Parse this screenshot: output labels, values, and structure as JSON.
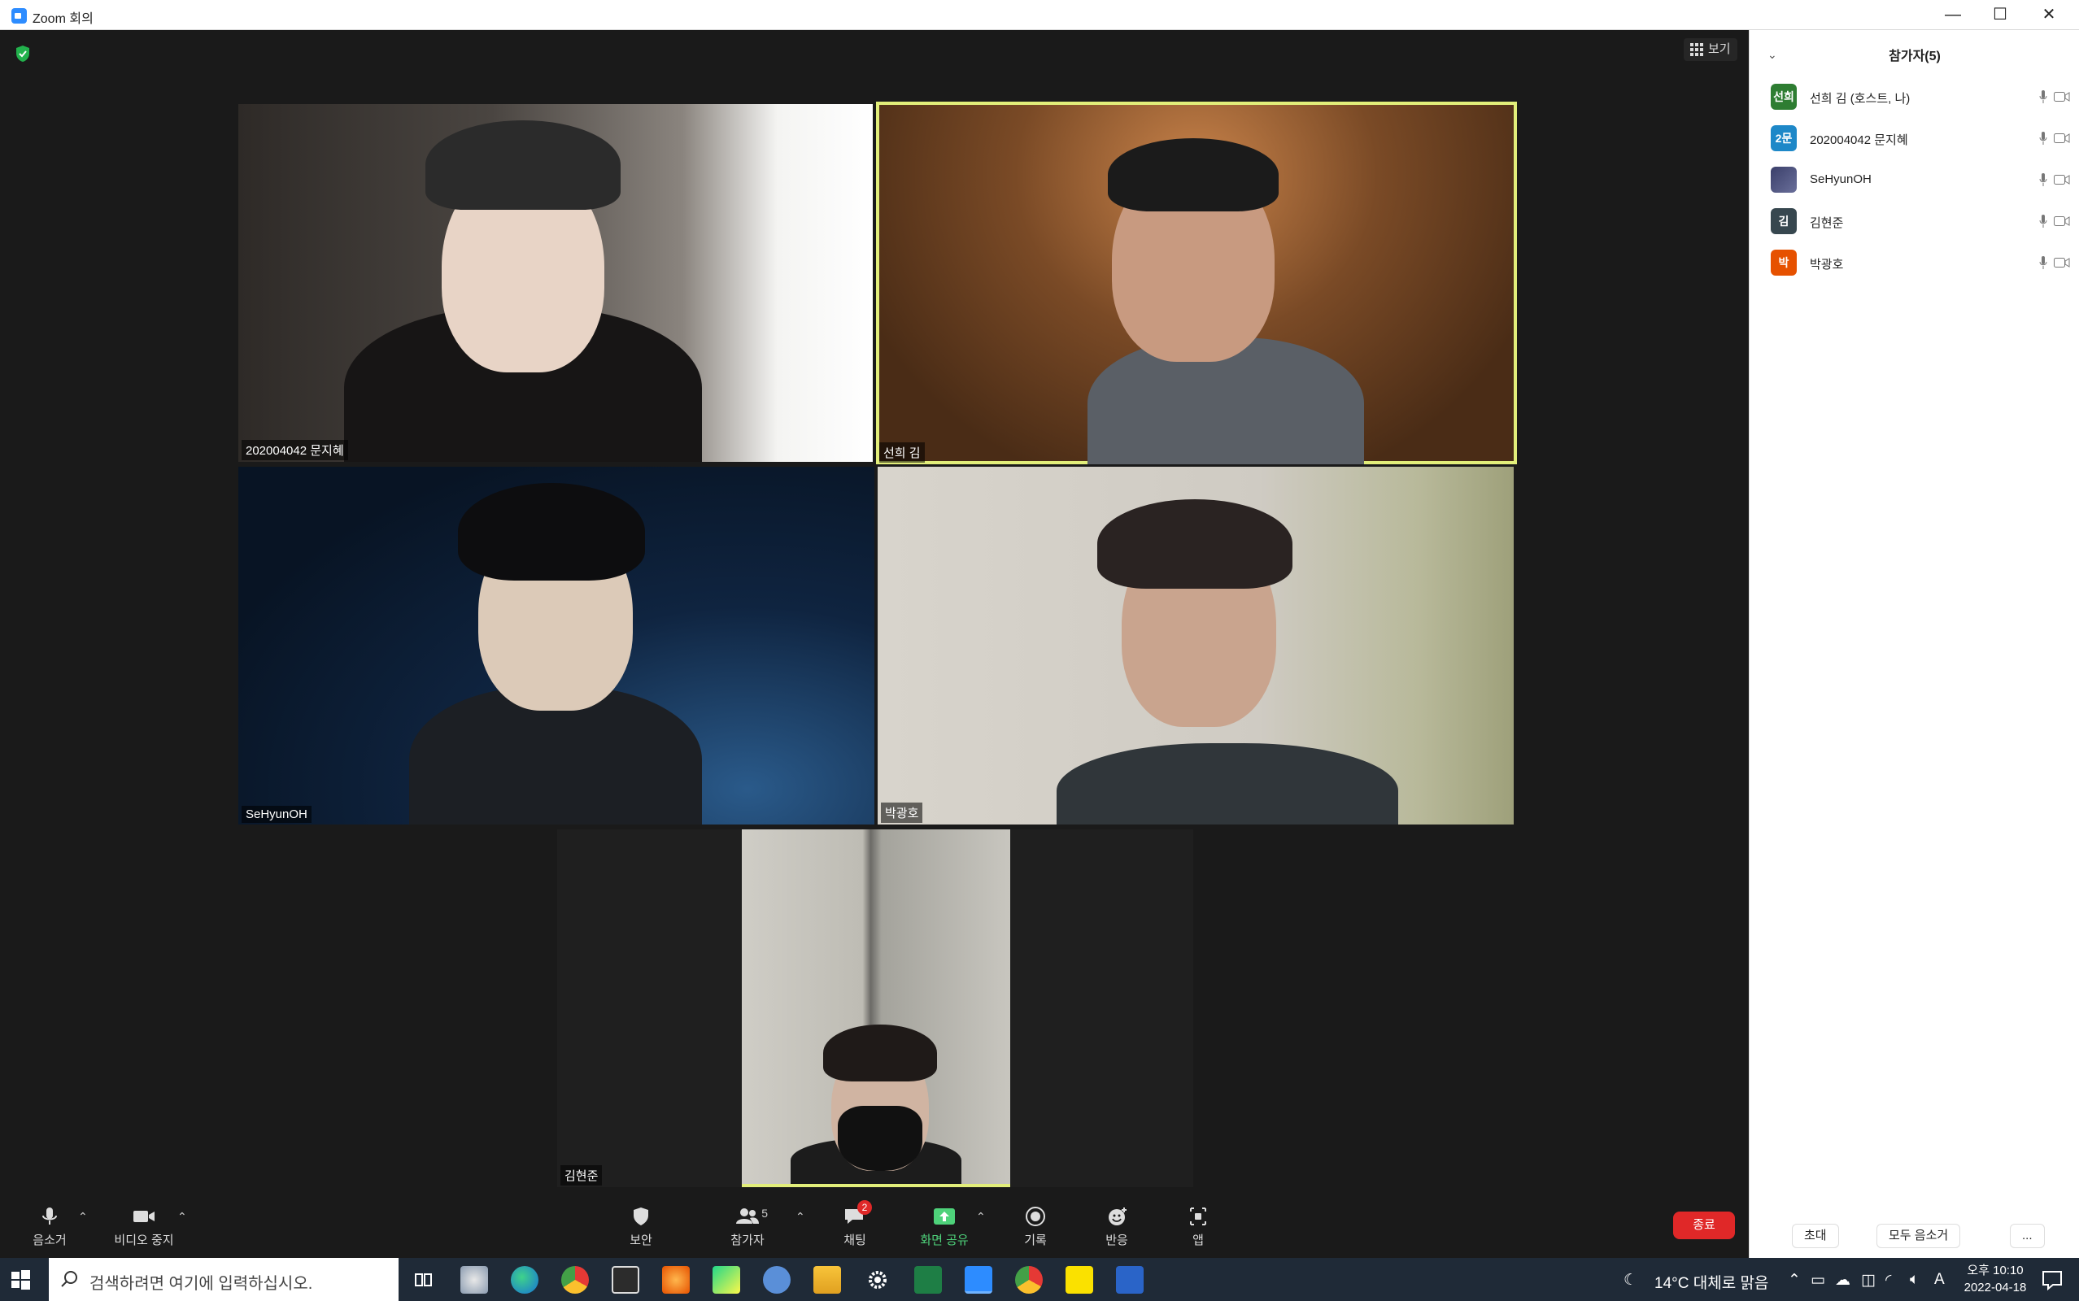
{
  "window": {
    "title": "Zoom 회의",
    "minimize": "—",
    "maximize": "☐",
    "close": "✕"
  },
  "meeting": {
    "view_button": "보기",
    "tiles": [
      {
        "name": "202004042 문지혜"
      },
      {
        "name": "선희 김",
        "active": true
      },
      {
        "name": "SeHyunOH"
      },
      {
        "name": "박광호"
      },
      {
        "name": "김현준"
      }
    ]
  },
  "toolbar": {
    "mute": "음소거",
    "video": "비디오 중지",
    "security": "보안",
    "participants": "참가자",
    "participants_count": "5",
    "chat": "채팅",
    "chat_badge": "2",
    "share": "화면 공유",
    "record": "기록",
    "reactions": "반응",
    "apps": "앱",
    "end": "종료"
  },
  "panel": {
    "title": "참가자(5)",
    "participants": [
      {
        "avatar": "선희",
        "name": "선희 김 (호스트, 나)",
        "color": "#2e7d32"
      },
      {
        "avatar": "2문",
        "name": "202004042 문지혜",
        "color": "#1e88c8"
      },
      {
        "avatar": "",
        "name": "SeHyunOH",
        "color": "#3a3f6a"
      },
      {
        "avatar": "김",
        "name": "김현준",
        "color": "#37474f"
      },
      {
        "avatar": "박",
        "name": "박광호",
        "color": "#e65100"
      }
    ],
    "invite": "초대",
    "mute_all": "모두 음소거",
    "more": "..."
  },
  "taskbar": {
    "search_placeholder": "검색하려면 여기에 입력하십시오.",
    "weather": "14°C  대체로 맑음",
    "ime": "A",
    "time_period": "오후 10:10",
    "date": "2022-04-18"
  },
  "colors": {
    "accent": "#2d8cff",
    "active_speaker": "#e2ee7a",
    "end": "#e02828",
    "share_green": "#4ed27a"
  }
}
